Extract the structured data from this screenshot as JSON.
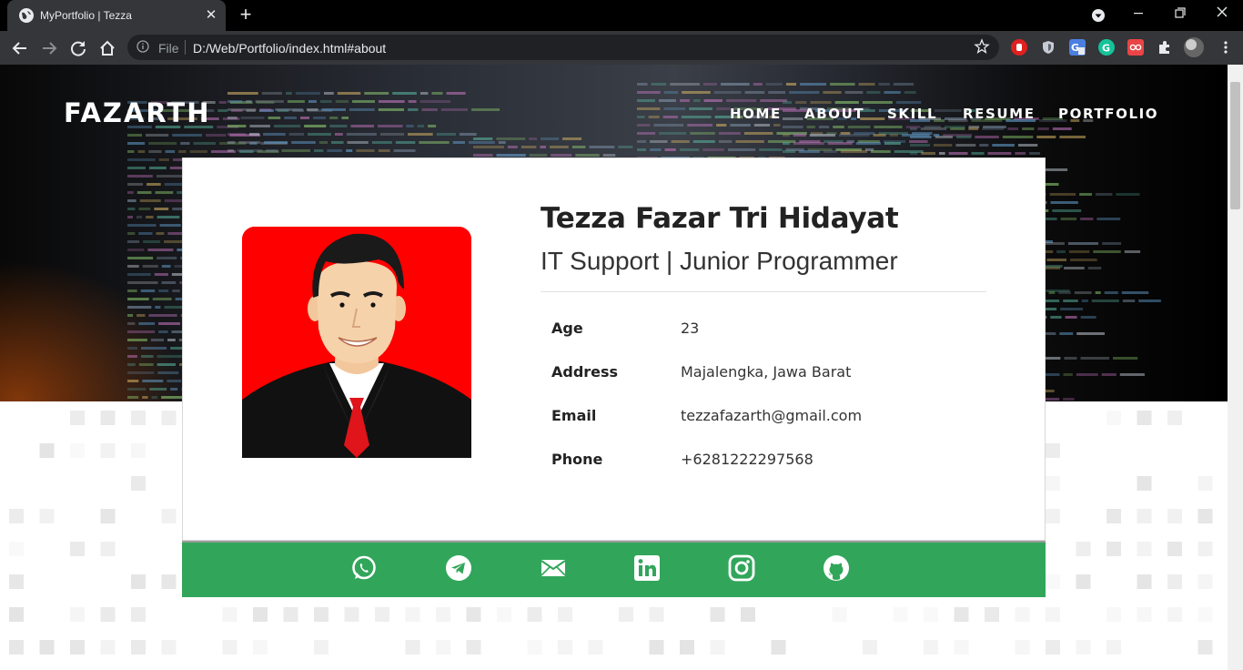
{
  "browser": {
    "tab_title": "MyPortfolio | Tezza",
    "url_scheme_label": "File",
    "url": "D:/Web/Portfolio/index.html#about"
  },
  "site": {
    "brand": "FAZARTH",
    "nav": [
      {
        "label": "HOME"
      },
      {
        "label": "ABOUT"
      },
      {
        "label": "SKILL"
      },
      {
        "label": "RESUME"
      },
      {
        "label": "PORTFOLIO"
      }
    ]
  },
  "profile": {
    "name": "Tezza Fazar Tri Hidayat",
    "role": "IT Support | Junior Programmer",
    "details": [
      {
        "label": "Age",
        "value": "23"
      },
      {
        "label": "Address",
        "value": "Majalengka, Jawa Barat"
      },
      {
        "label": "Email",
        "value": "tezzafazarth@gmail.com"
      },
      {
        "label": "Phone",
        "value": "+6281222297568"
      }
    ]
  },
  "social_links": [
    "whatsapp-icon",
    "telegram-icon",
    "email-icon",
    "linkedin-icon",
    "instagram-icon",
    "github-icon"
  ],
  "colors": {
    "social_bar": "#31a65b",
    "avatar_bg": "#ff0000",
    "browser_frame": "#35363a"
  }
}
